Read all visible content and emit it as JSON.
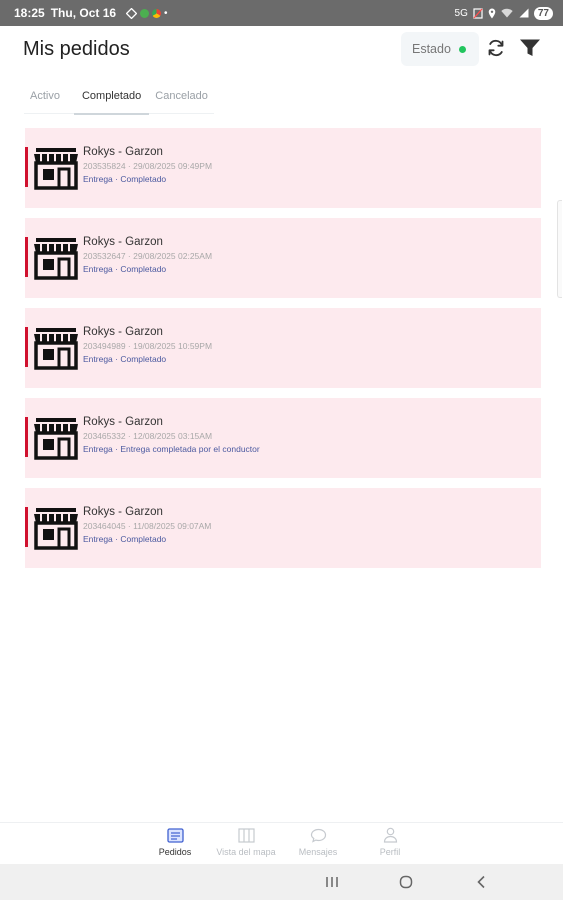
{
  "status_bar": {
    "time": "18:25",
    "date": "Thu, Oct 16",
    "right_text": "5G",
    "battery": "77"
  },
  "header": {
    "title": "Mis pedidos",
    "estado_label": "Estado",
    "estado_dot_color": "#22c55e"
  },
  "tabs": [
    {
      "label": "Activo"
    },
    {
      "label": "Completado"
    },
    {
      "label": "Cancelado"
    }
  ],
  "orders": [
    {
      "store": "Rokys - Garzon",
      "meta": "203535824 · 29/08/2025 09:49PM",
      "status": "Entrega · Completado"
    },
    {
      "store": "Rokys - Garzon",
      "meta": "203532647 · 29/08/2025 02:25AM",
      "status": "Entrega · Completado"
    },
    {
      "store": "Rokys - Garzon",
      "meta": "203494989 · 19/08/2025 10:59PM",
      "status": "Entrega · Completado"
    },
    {
      "store": "Rokys - Garzon",
      "meta": "203465332 · 12/08/2025 03:15AM",
      "status": "Entrega · Entrega completada por el conductor"
    },
    {
      "store": "Rokys - Garzon",
      "meta": "203464045 · 11/08/2025 09:07AM",
      "status": "Entrega · Completado"
    }
  ],
  "bottom_nav": [
    {
      "label": "Pedidos",
      "icon": "orders-list-icon"
    },
    {
      "label": "Vista del mapa",
      "icon": "map-icon"
    },
    {
      "label": "Mensajes",
      "icon": "chat-bubble-icon"
    },
    {
      "label": "Perfil",
      "icon": "person-icon"
    }
  ],
  "colors": {
    "card_background": "#fdeaee",
    "accent": "#d0102e",
    "status_text": "#4c5aa0"
  }
}
